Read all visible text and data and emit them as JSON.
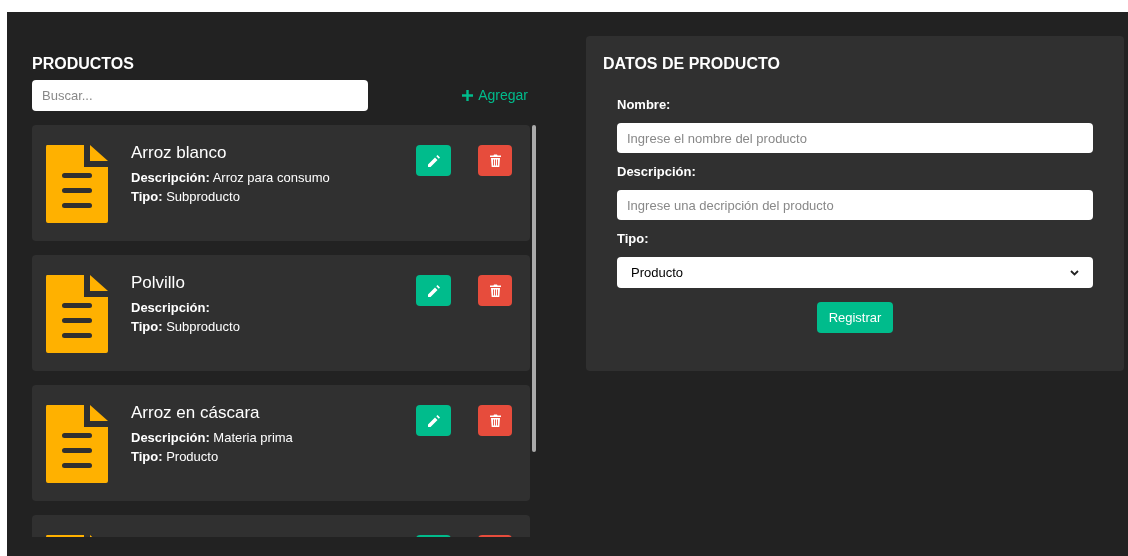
{
  "list": {
    "title": "PRODUCTOS",
    "search": {
      "placeholder": "Buscar..."
    },
    "add_label": "Agregar",
    "products": [
      {
        "kind": "full",
        "name": "Arroz blanco",
        "description_label": "Descripción:",
        "description": "Arroz para consumo",
        "type_label": "Tipo:",
        "type": "Subproducto"
      },
      {
        "kind": "full",
        "name": "Polvillo",
        "description_label": "Descripción:",
        "type_label": "Tipo:",
        "type": "Subproducto"
      },
      {
        "kind": "full",
        "name": "Arroz en cáscara",
        "description_label": "Descripción:",
        "description": "Materia prima",
        "type_label": "Tipo:",
        "type": "Producto"
      },
      {
        "kind": "cut_off"
      }
    ]
  },
  "form": {
    "title": "DATOS DE PRODUCTO",
    "fields": [
      {
        "kind": "text",
        "label": "Nombre:",
        "placeholder": "Ingrese el nombre del producto"
      },
      {
        "kind": "text",
        "label": "Descripción:",
        "placeholder": "Ingrese una decripción del producto"
      },
      {
        "kind": "select",
        "label": "Tipo:",
        "value": "Producto"
      }
    ],
    "submit": "Registrar"
  }
}
